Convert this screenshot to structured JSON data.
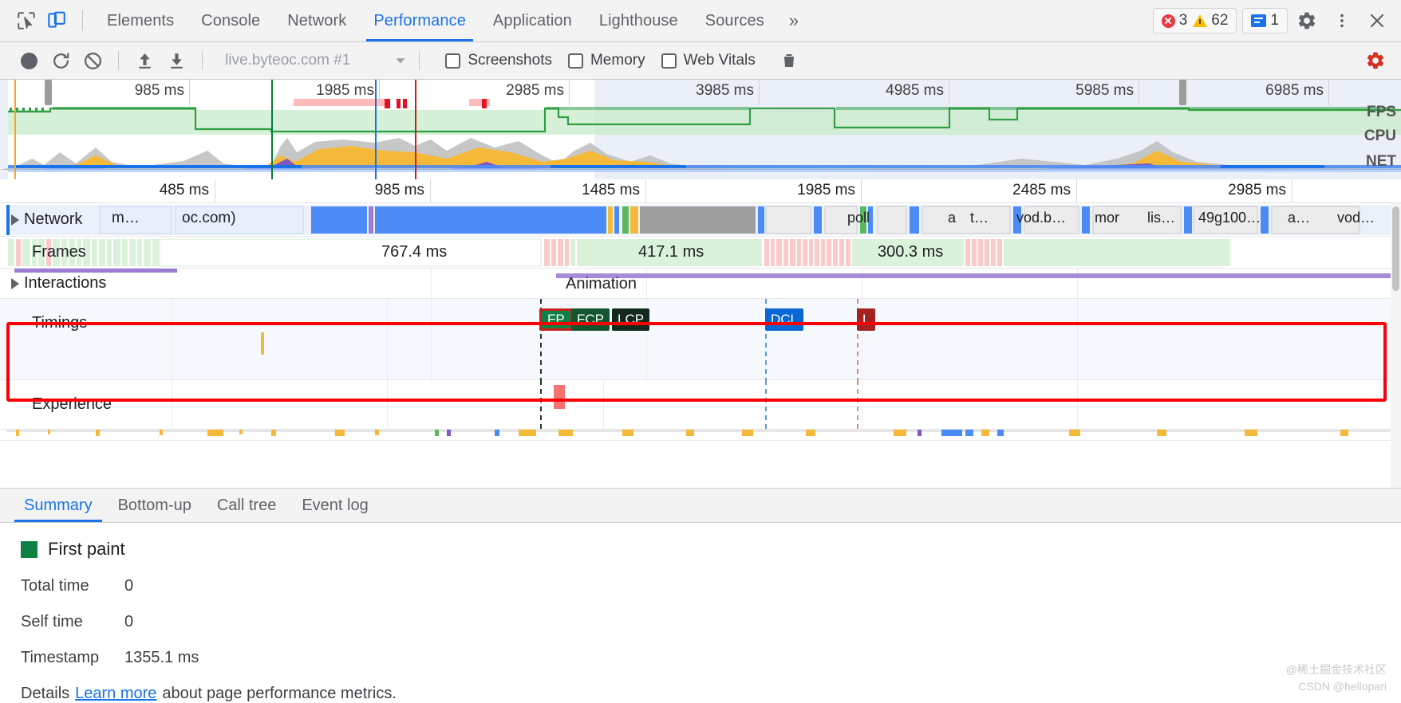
{
  "tabbar": {
    "inspect_icon": "inspect-cursor-icon",
    "device_icon": "device-toolbar-icon",
    "tabs": [
      {
        "label": "Elements",
        "selected": false
      },
      {
        "label": "Console",
        "selected": false
      },
      {
        "label": "Network",
        "selected": false
      },
      {
        "label": "Performance",
        "selected": true
      },
      {
        "label": "Application",
        "selected": false
      },
      {
        "label": "Lighthouse",
        "selected": false
      },
      {
        "label": "Sources",
        "selected": false
      }
    ],
    "more_label": "»",
    "errors_count": "3",
    "warnings_count": "62",
    "messages_count": "1",
    "settings_icon": "gear-icon",
    "menu_icon": "kebab-menu-icon",
    "close_icon": "close-icon",
    "accent_color": "#1a73e8"
  },
  "controlbar": {
    "record_icon": "record-circle-icon",
    "reload_icon": "reload-record-icon",
    "clear_icon": "clear-no-entry-icon",
    "load_icon": "load-profile-upload-icon",
    "save_icon": "save-profile-download-icon",
    "url": "live.byteoc.com #1",
    "dropdown_icon": "chevron-down-icon",
    "checkboxes": [
      {
        "label": "Screenshots",
        "checked": false
      },
      {
        "label": "Memory",
        "checked": false
      },
      {
        "label": "Web Vitals",
        "checked": false
      }
    ],
    "trash_icon": "trash-icon",
    "capture_settings_icon": "capture-settings-gear-icon"
  },
  "overview": {
    "ticks": [
      "985 ms",
      "1985 ms",
      "2985 ms",
      "3985 ms",
      "4985 ms",
      "5985 ms",
      "6985 ms"
    ],
    "lane_labels": [
      "FPS",
      "CPU",
      "NET"
    ]
  },
  "detail_ruler": {
    "ticks": [
      "485 ms",
      "985 ms",
      "1485 ms",
      "1985 ms",
      "2485 ms",
      "2985 ms"
    ]
  },
  "tracks": {
    "network": {
      "label": "Network",
      "expand_icon": "triangle-right-icon",
      "request_labels": [
        "m…",
        "oc.com)",
        "poll",
        "a",
        "t…",
        "vod.b…",
        "mor",
        "lis…",
        "49g100…",
        "a…",
        "vod…"
      ]
    },
    "frames": {
      "label": "Frames",
      "durations": [
        "767.4 ms",
        "417.1 ms",
        "300.3 ms"
      ]
    },
    "interactions": {
      "label": "Interactions",
      "expand_icon": "triangle-right-icon",
      "entry_label": "Animation"
    },
    "timings": {
      "label": "Timings",
      "markers": [
        {
          "label": "FP",
          "color": "#0e8043"
        },
        {
          "label": "FCP",
          "color": "#13562e"
        },
        {
          "label": "LCP",
          "color": "#13291b"
        },
        {
          "label": "DCL",
          "color": "#0867d4"
        },
        {
          "label": "L",
          "color": "#a52222"
        }
      ],
      "highlighted": true,
      "highlight_color": "#fb0007"
    },
    "experience": {
      "label": "Experience"
    }
  },
  "bottom": {
    "tabs": [
      {
        "label": "Summary",
        "selected": true
      },
      {
        "label": "Bottom-up",
        "selected": false
      },
      {
        "label": "Call tree",
        "selected": false
      },
      {
        "label": "Event log",
        "selected": false
      }
    ],
    "summary": {
      "swatch_color": "#0e8043",
      "title": "First paint",
      "rows": [
        {
          "key": "Total time",
          "value": "0"
        },
        {
          "key": "Self time",
          "value": "0"
        },
        {
          "key": "Timestamp",
          "value": "1355.1 ms"
        }
      ],
      "details_label": "Details",
      "details_link": "Learn more",
      "details_suffix": "about page performance metrics."
    }
  },
  "watermark": {
    "line1": "@稀土掘金技术社区",
    "line2": "CSDN @hellopari"
  }
}
